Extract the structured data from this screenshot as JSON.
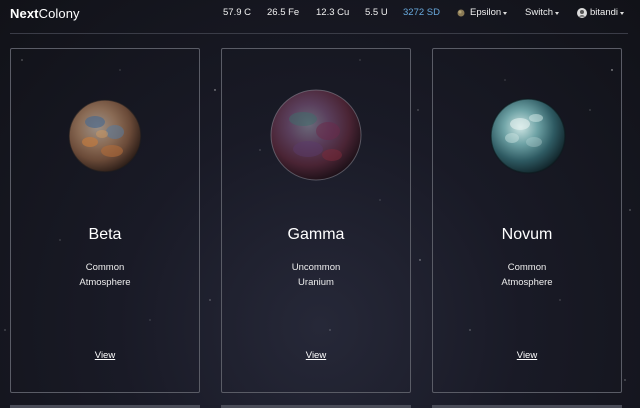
{
  "brand": {
    "bold": "Next",
    "rest": "Colony"
  },
  "resources": [
    {
      "label": "57.9 C"
    },
    {
      "label": "26.5 Fe"
    },
    {
      "label": "12.3 Cu"
    },
    {
      "label": "5.5 U"
    },
    {
      "label": "3272 SD"
    }
  ],
  "planet_menu": {
    "label": "Epsilon"
  },
  "switch_menu": {
    "label": "Switch"
  },
  "user_menu": {
    "label": "bitandi"
  },
  "cards": [
    {
      "name": "Beta",
      "rarity": "Common",
      "type": "Atmosphere",
      "link": "View"
    },
    {
      "name": "Gamma",
      "rarity": "Uncommon",
      "type": "Uranium",
      "link": "View"
    },
    {
      "name": "Novum",
      "rarity": "Common",
      "type": "Atmosphere",
      "link": "View"
    }
  ],
  "colors": {
    "sd": "#68a9dd",
    "card_border": "#5a5c66",
    "background": "#191a26"
  }
}
